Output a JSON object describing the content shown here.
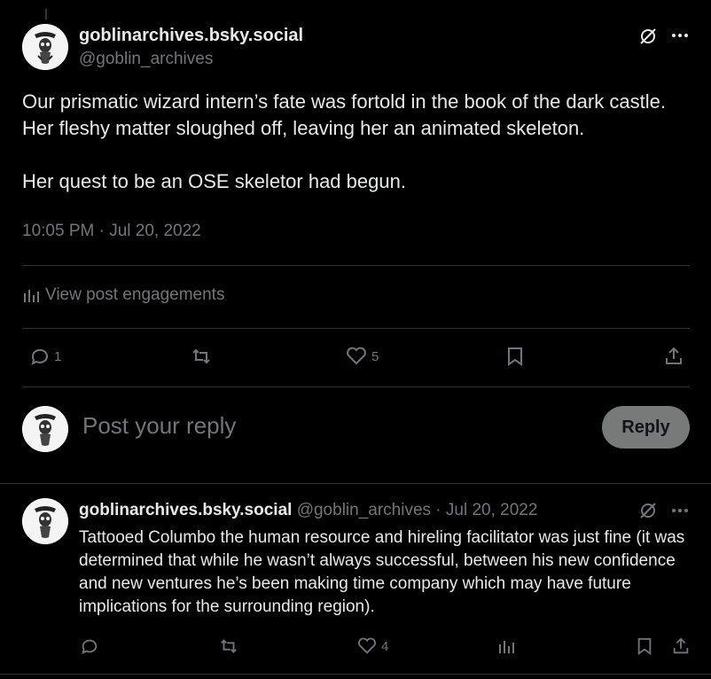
{
  "post": {
    "display_name": "goblinarchives.bsky.social",
    "handle": "@goblin_archives",
    "text": "Our prismatic wizard intern’s fate was fortold in the book of the dark castle. Her fleshy matter sloughed off, leaving her an animated skeleton.\n\nHer quest to be an OSE skeletor had begun.",
    "timestamp": "10:05 PM · Jul 20, 2022",
    "engagements_label": "View post engagements",
    "reply_count": "1",
    "like_count": "5"
  },
  "composer": {
    "placeholder": "Post your reply",
    "button_label": "Reply"
  },
  "reply_post": {
    "display_name": "goblinarchives.bsky.social",
    "handle_date": "@goblin_archives · Jul 20, 2022",
    "text": "Tattooed Columbo the human resource and hireling facilitator was just fine (it was determined that while he wasn’t always successful, between his new confidence and new ventures he’s been making time company which may have future implications for the surrounding region).",
    "like_count": "4"
  },
  "colors": {
    "background": "#000000",
    "text": "#e7e9ea",
    "muted": "#71767b",
    "divider": "#2f3336",
    "reply_button": "#787a7a"
  },
  "icons": [
    "crossed-circle-icon",
    "more-icon",
    "bar-chart-icon",
    "comment-icon",
    "repost-icon",
    "heart-icon",
    "bookmark-icon",
    "share-icon"
  ]
}
